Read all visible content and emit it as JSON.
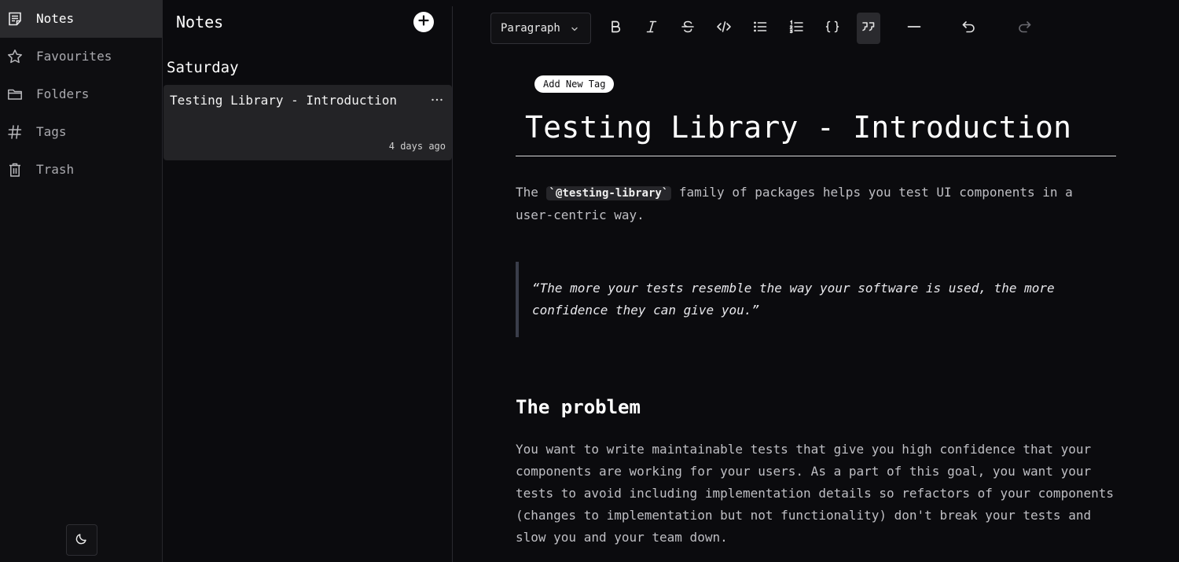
{
  "nav": {
    "items": [
      {
        "label": "Notes",
        "icon": "note-icon"
      },
      {
        "label": "Favourites",
        "icon": "star-icon"
      },
      {
        "label": "Folders",
        "icon": "folder-icon"
      },
      {
        "label": "Tags",
        "icon": "hash-icon"
      },
      {
        "label": "Trash",
        "icon": "trash-icon"
      }
    ],
    "theme_icon": "moon-icon"
  },
  "list": {
    "title": "Notes",
    "group": "Saturday",
    "notes": [
      {
        "title": "Testing Library - Introduction",
        "date": "4 days ago"
      }
    ]
  },
  "toolbar": {
    "block_type": "Paragraph"
  },
  "editor": {
    "tag_button": "Add New Tag",
    "title": "Testing Library - Introduction",
    "p1_before": "The ",
    "p1_code": "`@testing-library`",
    "p1_after": " family of packages helps you test UI components in a user-centric way.",
    "quote": "“The more your tests resemble the way your software is used, the more confidence they can give you.”",
    "heading": "The problem",
    "p2": "You want to write maintainable tests that give you high confidence that your components are working for your users. As a part of this goal, you want your tests to avoid including implementation details so refactors of your components (changes to implementation but not functionality) don't break your tests and slow you and your team down."
  },
  "colors": {
    "background": "#0b0b0e",
    "active_nav": "#2a2a2d",
    "card": "#232326",
    "quote_border": "#3a3d4a"
  }
}
